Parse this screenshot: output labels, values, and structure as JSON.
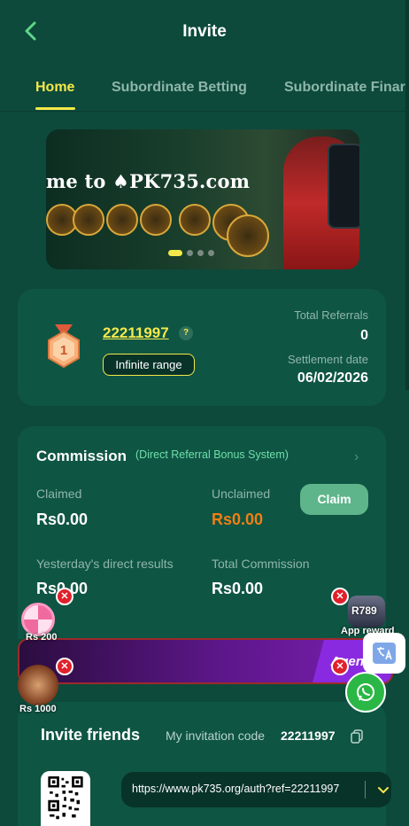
{
  "header": {
    "title": "Invite"
  },
  "tabs": [
    {
      "label": "Home"
    },
    {
      "label": "Subordinate Betting"
    },
    {
      "label": "Subordinate Finar"
    }
  ],
  "banner": {
    "text": "me to ♠PK735.com"
  },
  "referral": {
    "user_id": "22211997",
    "help": "?",
    "range_label": "Infinite range",
    "total_referrals_label": "Total Referrals",
    "total_referrals_value": "0",
    "settlement_label": "Settlement date",
    "settlement_value": "06/02/2026"
  },
  "commission": {
    "title": "Commission",
    "subtitle": "(Direct Referral Bonus System)",
    "claimed_label": "Claimed",
    "claimed_value": "Rs0.00",
    "unclaimed_label": "Unclaimed",
    "unclaimed_value": "Rs0.00",
    "claim_button": "Claim",
    "yesterday_label": "Yesterday's direct results",
    "yesterday_value": "Rs0.00",
    "total_label": "Total Commission",
    "total_value": "Rs0.00"
  },
  "promo_bar": {
    "text": "Agent"
  },
  "floating": {
    "wheel_label": "Rs 200",
    "avatar_label": "Rs 1000",
    "app_label": "App reward",
    "app_brand": "R789",
    "close": "✕"
  },
  "invite": {
    "title": "Invite friends",
    "code_label": "My invitation code",
    "code_value": "22211997",
    "link": "https://www.pk735.org/auth?ref=22211997"
  },
  "colors": {
    "background": "#0d4a3b",
    "card": "#0f5544",
    "accent": "#f4e94a",
    "unclaimed": "#f07f12",
    "claim_button": "#5fb58b"
  }
}
